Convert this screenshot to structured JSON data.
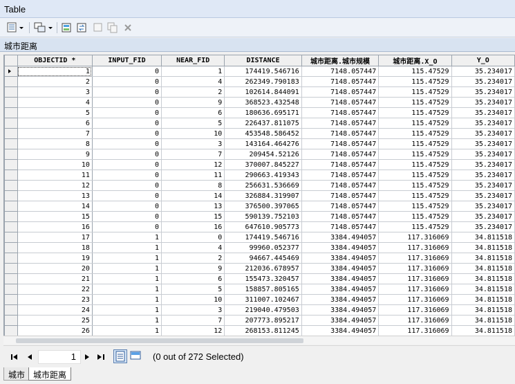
{
  "window": {
    "title": "Table"
  },
  "toolbar": {
    "icons": [
      "table-options-icon",
      "related-tables-icon",
      "select-by-attributes-icon",
      "switch-selection-icon",
      "clear-selection-icon",
      "copy-selected-icon",
      "delete-selected-icon"
    ]
  },
  "table_name": "城市距离",
  "columns": [
    "OBJECTID *",
    "INPUT_FID",
    "NEAR_FID",
    "DISTANCE",
    "城市距离.城市规模",
    "城市距离.X_O",
    "Y_O"
  ],
  "rows": [
    [
      "1",
      "0",
      "1",
      "174419.546716",
      "7148.057447",
      "115.47529",
      "35.234017"
    ],
    [
      "2",
      "0",
      "4",
      "262349.790183",
      "7148.057447",
      "115.47529",
      "35.234017"
    ],
    [
      "3",
      "0",
      "2",
      "102614.844091",
      "7148.057447",
      "115.47529",
      "35.234017"
    ],
    [
      "4",
      "0",
      "9",
      "368523.432548",
      "7148.057447",
      "115.47529",
      "35.234017"
    ],
    [
      "5",
      "0",
      "6",
      "180636.695171",
      "7148.057447",
      "115.47529",
      "35.234017"
    ],
    [
      "6",
      "0",
      "5",
      "226437.811075",
      "7148.057447",
      "115.47529",
      "35.234017"
    ],
    [
      "7",
      "0",
      "10",
      "453548.586452",
      "7148.057447",
      "115.47529",
      "35.234017"
    ],
    [
      "8",
      "0",
      "3",
      "143164.464276",
      "7148.057447",
      "115.47529",
      "35.234017"
    ],
    [
      "9",
      "0",
      "7",
      "209454.52126",
      "7148.057447",
      "115.47529",
      "35.234017"
    ],
    [
      "10",
      "0",
      "12",
      "370007.845227",
      "7148.057447",
      "115.47529",
      "35.234017"
    ],
    [
      "11",
      "0",
      "11",
      "290663.419343",
      "7148.057447",
      "115.47529",
      "35.234017"
    ],
    [
      "12",
      "0",
      "8",
      "256631.536669",
      "7148.057447",
      "115.47529",
      "35.234017"
    ],
    [
      "13",
      "0",
      "14",
      "326884.319907",
      "7148.057447",
      "115.47529",
      "35.234017"
    ],
    [
      "14",
      "0",
      "13",
      "376500.397065",
      "7148.057447",
      "115.47529",
      "35.234017"
    ],
    [
      "15",
      "0",
      "15",
      "590139.752103",
      "7148.057447",
      "115.47529",
      "35.234017"
    ],
    [
      "16",
      "0",
      "16",
      "647610.905773",
      "7148.057447",
      "115.47529",
      "35.234017"
    ],
    [
      "17",
      "1",
      "0",
      "174419.546716",
      "3384.494057",
      "117.316069",
      "34.811518"
    ],
    [
      "18",
      "1",
      "4",
      "99960.052377",
      "3384.494057",
      "117.316069",
      "34.811518"
    ],
    [
      "19",
      "1",
      "2",
      "94667.445469",
      "3384.494057",
      "117.316069",
      "34.811518"
    ],
    [
      "20",
      "1",
      "9",
      "212036.678957",
      "3384.494057",
      "117.316069",
      "34.811518"
    ],
    [
      "21",
      "1",
      "6",
      "155473.320457",
      "3384.494057",
      "117.316069",
      "34.811518"
    ],
    [
      "22",
      "1",
      "5",
      "158857.805165",
      "3384.494057",
      "117.316069",
      "34.811518"
    ],
    [
      "23",
      "1",
      "10",
      "311007.102467",
      "3384.494057",
      "117.316069",
      "34.811518"
    ],
    [
      "24",
      "1",
      "3",
      "219040.479503",
      "3384.494057",
      "117.316069",
      "34.811518"
    ],
    [
      "25",
      "1",
      "7",
      "207773.895217",
      "3384.494057",
      "117.316069",
      "34.811518"
    ],
    [
      "26",
      "1",
      "12",
      "268153.811245",
      "3384.494057",
      "117.316069",
      "34.811518"
    ]
  ],
  "navigation": {
    "current_record": "1",
    "selection_status": "(0 out of 272 Selected)"
  },
  "tabs": [
    {
      "label": "城市",
      "active": false
    },
    {
      "label": "城市距离",
      "active": true
    }
  ]
}
